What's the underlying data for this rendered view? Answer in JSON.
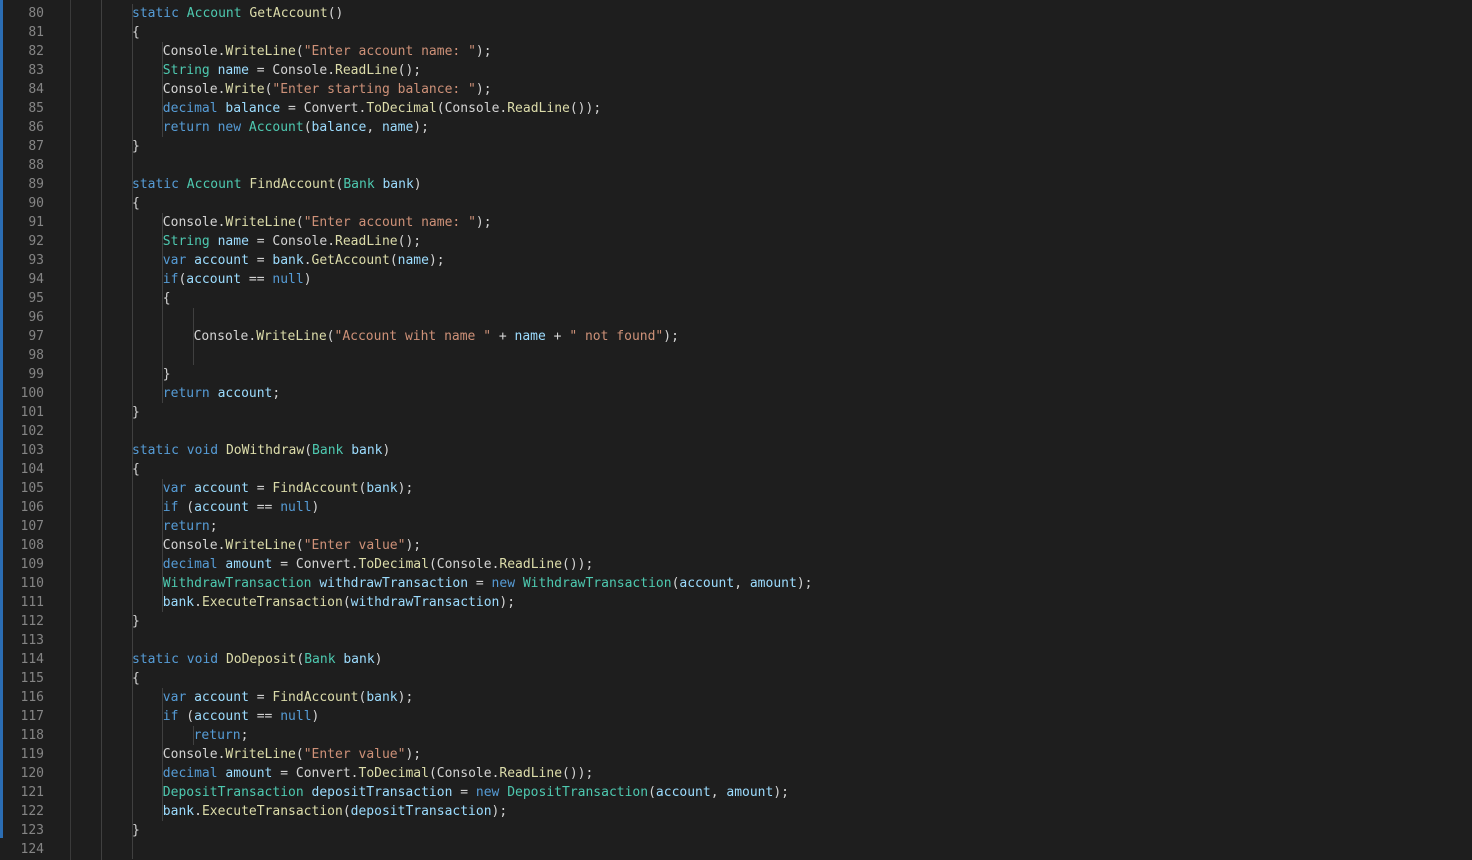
{
  "editor": {
    "colors": {
      "background": "#1e1e1e",
      "line_number": "#858585",
      "keyword": "#569cd6",
      "type": "#4ec9b0",
      "method": "#dcdcaa",
      "variable": "#9cdcfe",
      "string": "#ce9178",
      "plain": "#d4d4d4"
    },
    "lines": [
      {
        "no": "80",
        "indent": 1,
        "tokens": [
          [
            "static ",
            "kw"
          ],
          [
            "Account ",
            "type"
          ],
          [
            "GetAccount",
            "fn"
          ],
          [
            "()",
            "p"
          ]
        ]
      },
      {
        "no": "81",
        "indent": 1,
        "tokens": [
          [
            "{",
            "p"
          ]
        ]
      },
      {
        "no": "82",
        "indent": 2,
        "tokens": [
          [
            "Console",
            "type"
          ],
          [
            ".",
            "p"
          ],
          [
            "WriteLine",
            "fn"
          ],
          [
            "(",
            "p"
          ],
          [
            "\"Enter account name: \"",
            "str"
          ],
          [
            ");",
            "p"
          ]
        ]
      },
      {
        "no": "83",
        "indent": 2,
        "tokens": [
          [
            "String ",
            "type"
          ],
          [
            "name",
            "var"
          ],
          [
            " = ",
            "p"
          ],
          [
            "Console",
            "type"
          ],
          [
            ".",
            "p"
          ],
          [
            "ReadLine",
            "fn"
          ],
          [
            "();",
            "p"
          ]
        ]
      },
      {
        "no": "84",
        "indent": 2,
        "tokens": [
          [
            "Console",
            "type"
          ],
          [
            ".",
            "p"
          ],
          [
            "Write",
            "fn"
          ],
          [
            "(",
            "p"
          ],
          [
            "\"Enter starting balance: \"",
            "str"
          ],
          [
            ");",
            "p"
          ]
        ]
      },
      {
        "no": "85",
        "indent": 2,
        "tokens": [
          [
            "decimal ",
            "kw"
          ],
          [
            "balance",
            "var"
          ],
          [
            " = ",
            "p"
          ],
          [
            "Convert",
            "type"
          ],
          [
            ".",
            "p"
          ],
          [
            "ToDecimal",
            "fn"
          ],
          [
            "(",
            "p"
          ],
          [
            "Console",
            "type"
          ],
          [
            ".",
            "p"
          ],
          [
            "ReadLine",
            "fn"
          ],
          [
            "());",
            "p"
          ]
        ]
      },
      {
        "no": "86",
        "indent": 2,
        "tokens": [
          [
            "return ",
            "kw2"
          ],
          [
            "new ",
            "kw"
          ],
          [
            "Account",
            "type"
          ],
          [
            "(",
            "p"
          ],
          [
            "balance",
            "var"
          ],
          [
            ", ",
            "p"
          ],
          [
            "name",
            "var"
          ],
          [
            ");",
            "p"
          ]
        ]
      },
      {
        "no": "87",
        "indent": 1,
        "tokens": [
          [
            "}",
            "p"
          ]
        ]
      },
      {
        "no": "88",
        "indent": 0,
        "tokens": []
      },
      {
        "no": "89",
        "indent": 1,
        "tokens": [
          [
            "static ",
            "kw"
          ],
          [
            "Account ",
            "type"
          ],
          [
            "FindAccount",
            "fn"
          ],
          [
            "(",
            "p"
          ],
          [
            "Bank ",
            "type"
          ],
          [
            "bank",
            "var"
          ],
          [
            ")",
            "p"
          ]
        ]
      },
      {
        "no": "90",
        "indent": 1,
        "tokens": [
          [
            "{",
            "p"
          ]
        ]
      },
      {
        "no": "91",
        "indent": 2,
        "tokens": [
          [
            "Console",
            "type"
          ],
          [
            ".",
            "p"
          ],
          [
            "WriteLine",
            "fn"
          ],
          [
            "(",
            "p"
          ],
          [
            "\"Enter account name: \"",
            "str"
          ],
          [
            ");",
            "p"
          ]
        ]
      },
      {
        "no": "92",
        "indent": 2,
        "tokens": [
          [
            "String ",
            "type"
          ],
          [
            "name",
            "var"
          ],
          [
            " = ",
            "p"
          ],
          [
            "Console",
            "type"
          ],
          [
            ".",
            "p"
          ],
          [
            "ReadLine",
            "fn"
          ],
          [
            "();",
            "p"
          ]
        ]
      },
      {
        "no": "93",
        "indent": 2,
        "tokens": [
          [
            "var ",
            "kw"
          ],
          [
            "account",
            "var"
          ],
          [
            " = ",
            "p"
          ],
          [
            "bank",
            "var"
          ],
          [
            ".",
            "p"
          ],
          [
            "GetAccount",
            "fn"
          ],
          [
            "(",
            "p"
          ],
          [
            "name",
            "var"
          ],
          [
            ");",
            "p"
          ]
        ]
      },
      {
        "no": "94",
        "indent": 2,
        "tokens": [
          [
            "if",
            "kw2"
          ],
          [
            "(",
            "p"
          ],
          [
            "account",
            "var"
          ],
          [
            " == ",
            "p"
          ],
          [
            "null",
            "kw"
          ],
          [
            ")",
            "p"
          ]
        ]
      },
      {
        "no": "95",
        "indent": 2,
        "tokens": [
          [
            "{",
            "p"
          ]
        ]
      },
      {
        "no": "96",
        "indent": 0,
        "tokens": []
      },
      {
        "no": "97",
        "indent": 3,
        "tokens": [
          [
            "Console",
            "type"
          ],
          [
            ".",
            "p"
          ],
          [
            "WriteLine",
            "fn"
          ],
          [
            "(",
            "p"
          ],
          [
            "\"Account wiht name \"",
            "str"
          ],
          [
            " + ",
            "p"
          ],
          [
            "name",
            "var"
          ],
          [
            " + ",
            "p"
          ],
          [
            "\" not found\"",
            "str"
          ],
          [
            ");",
            "p"
          ]
        ]
      },
      {
        "no": "98",
        "indent": 0,
        "tokens": []
      },
      {
        "no": "99",
        "indent": 2,
        "tokens": [
          [
            "}",
            "p"
          ]
        ]
      },
      {
        "no": "100",
        "indent": 2,
        "tokens": [
          [
            "return ",
            "kw2"
          ],
          [
            "account",
            "var"
          ],
          [
            ";",
            "p"
          ]
        ]
      },
      {
        "no": "101",
        "indent": 1,
        "tokens": [
          [
            "}",
            "p"
          ]
        ]
      },
      {
        "no": "102",
        "indent": 0,
        "tokens": []
      },
      {
        "no": "103",
        "indent": 1,
        "tokens": [
          [
            "static ",
            "kw"
          ],
          [
            "void ",
            "kw"
          ],
          [
            "DoWithdraw",
            "fn"
          ],
          [
            "(",
            "p"
          ],
          [
            "Bank ",
            "type"
          ],
          [
            "bank",
            "var"
          ],
          [
            ")",
            "p"
          ]
        ]
      },
      {
        "no": "104",
        "indent": 1,
        "tokens": [
          [
            "{",
            "p"
          ]
        ]
      },
      {
        "no": "105",
        "indent": 2,
        "tokens": [
          [
            "var ",
            "kw"
          ],
          [
            "account",
            "var"
          ],
          [
            " = ",
            "p"
          ],
          [
            "FindAccount",
            "fn"
          ],
          [
            "(",
            "p"
          ],
          [
            "bank",
            "var"
          ],
          [
            ");",
            "p"
          ]
        ]
      },
      {
        "no": "106",
        "indent": 2,
        "tokens": [
          [
            "if ",
            "kw2"
          ],
          [
            "(",
            "p"
          ],
          [
            "account",
            "var"
          ],
          [
            " == ",
            "p"
          ],
          [
            "null",
            "kw"
          ],
          [
            ")",
            "p"
          ]
        ]
      },
      {
        "no": "107",
        "indent": 2,
        "tokens": [
          [
            "return",
            "kw2"
          ],
          [
            ";",
            "p"
          ]
        ]
      },
      {
        "no": "108",
        "indent": 2,
        "tokens": [
          [
            "Console",
            "type"
          ],
          [
            ".",
            "p"
          ],
          [
            "WriteLine",
            "fn"
          ],
          [
            "(",
            "p"
          ],
          [
            "\"Enter value\"",
            "str"
          ],
          [
            ");",
            "p"
          ]
        ]
      },
      {
        "no": "109",
        "indent": 2,
        "tokens": [
          [
            "decimal ",
            "kw"
          ],
          [
            "amount",
            "var"
          ],
          [
            " = ",
            "p"
          ],
          [
            "Convert",
            "type"
          ],
          [
            ".",
            "p"
          ],
          [
            "ToDecimal",
            "fn"
          ],
          [
            "(",
            "p"
          ],
          [
            "Console",
            "type"
          ],
          [
            ".",
            "p"
          ],
          [
            "ReadLine",
            "fn"
          ],
          [
            "());",
            "p"
          ]
        ]
      },
      {
        "no": "110",
        "indent": 2,
        "tokens": [
          [
            "WithdrawTransaction ",
            "type"
          ],
          [
            "withdrawTransaction",
            "var"
          ],
          [
            " = ",
            "p"
          ],
          [
            "new ",
            "kw"
          ],
          [
            "WithdrawTransaction",
            "type"
          ],
          [
            "(",
            "p"
          ],
          [
            "account",
            "var"
          ],
          [
            ", ",
            "p"
          ],
          [
            "amount",
            "var"
          ],
          [
            ");",
            "p"
          ]
        ]
      },
      {
        "no": "111",
        "indent": 2,
        "tokens": [
          [
            "bank",
            "var"
          ],
          [
            ".",
            "p"
          ],
          [
            "ExecuteTransaction",
            "fn"
          ],
          [
            "(",
            "p"
          ],
          [
            "withdrawTransaction",
            "var"
          ],
          [
            ");",
            "p"
          ]
        ]
      },
      {
        "no": "112",
        "indent": 1,
        "tokens": [
          [
            "}",
            "p"
          ]
        ]
      },
      {
        "no": "113",
        "indent": 0,
        "tokens": []
      },
      {
        "no": "114",
        "indent": 1,
        "tokens": [
          [
            "static ",
            "kw"
          ],
          [
            "void ",
            "kw"
          ],
          [
            "DoDeposit",
            "fn"
          ],
          [
            "(",
            "p"
          ],
          [
            "Bank ",
            "type"
          ],
          [
            "bank",
            "var"
          ],
          [
            ")",
            "p"
          ]
        ]
      },
      {
        "no": "115",
        "indent": 1,
        "tokens": [
          [
            "{",
            "p"
          ]
        ]
      },
      {
        "no": "116",
        "indent": 2,
        "tokens": [
          [
            "var ",
            "kw"
          ],
          [
            "account",
            "var"
          ],
          [
            " = ",
            "p"
          ],
          [
            "FindAccount",
            "fn"
          ],
          [
            "(",
            "p"
          ],
          [
            "bank",
            "var"
          ],
          [
            ");",
            "p"
          ]
        ]
      },
      {
        "no": "117",
        "indent": 2,
        "tokens": [
          [
            "if ",
            "kw2"
          ],
          [
            "(",
            "p"
          ],
          [
            "account",
            "var"
          ],
          [
            " == ",
            "p"
          ],
          [
            "null",
            "kw"
          ],
          [
            ")",
            "p"
          ]
        ]
      },
      {
        "no": "118",
        "indent": 3,
        "tokens": [
          [
            "return",
            "kw2"
          ],
          [
            ";",
            "p"
          ]
        ]
      },
      {
        "no": "119",
        "indent": 2,
        "tokens": [
          [
            "Console",
            "type"
          ],
          [
            ".",
            "p"
          ],
          [
            "WriteLine",
            "fn"
          ],
          [
            "(",
            "p"
          ],
          [
            "\"Enter value\"",
            "str"
          ],
          [
            ");",
            "p"
          ]
        ]
      },
      {
        "no": "120",
        "indent": 2,
        "tokens": [
          [
            "decimal ",
            "kw"
          ],
          [
            "amount",
            "var"
          ],
          [
            " = ",
            "p"
          ],
          [
            "Convert",
            "type"
          ],
          [
            ".",
            "p"
          ],
          [
            "ToDecimal",
            "fn"
          ],
          [
            "(",
            "p"
          ],
          [
            "Console",
            "type"
          ],
          [
            ".",
            "p"
          ],
          [
            "ReadLine",
            "fn"
          ],
          [
            "());",
            "p"
          ]
        ]
      },
      {
        "no": "121",
        "indent": 2,
        "tokens": [
          [
            "DepositTransaction ",
            "type"
          ],
          [
            "depositTransaction",
            "var"
          ],
          [
            " = ",
            "p"
          ],
          [
            "new ",
            "kw"
          ],
          [
            "DepositTransaction",
            "type"
          ],
          [
            "(",
            "p"
          ],
          [
            "account",
            "var"
          ],
          [
            ", ",
            "p"
          ],
          [
            "amount",
            "var"
          ],
          [
            ");",
            "p"
          ]
        ]
      },
      {
        "no": "122",
        "indent": 2,
        "tokens": [
          [
            "bank",
            "var"
          ],
          [
            ".",
            "p"
          ],
          [
            "ExecuteTransaction",
            "fn"
          ],
          [
            "(",
            "p"
          ],
          [
            "depositTransaction",
            "var"
          ],
          [
            ");",
            "p"
          ]
        ]
      },
      {
        "no": "123",
        "indent": 1,
        "tokens": [
          [
            "}",
            "p"
          ]
        ]
      },
      {
        "no": "124",
        "indent": 0,
        "tokens": []
      }
    ]
  }
}
